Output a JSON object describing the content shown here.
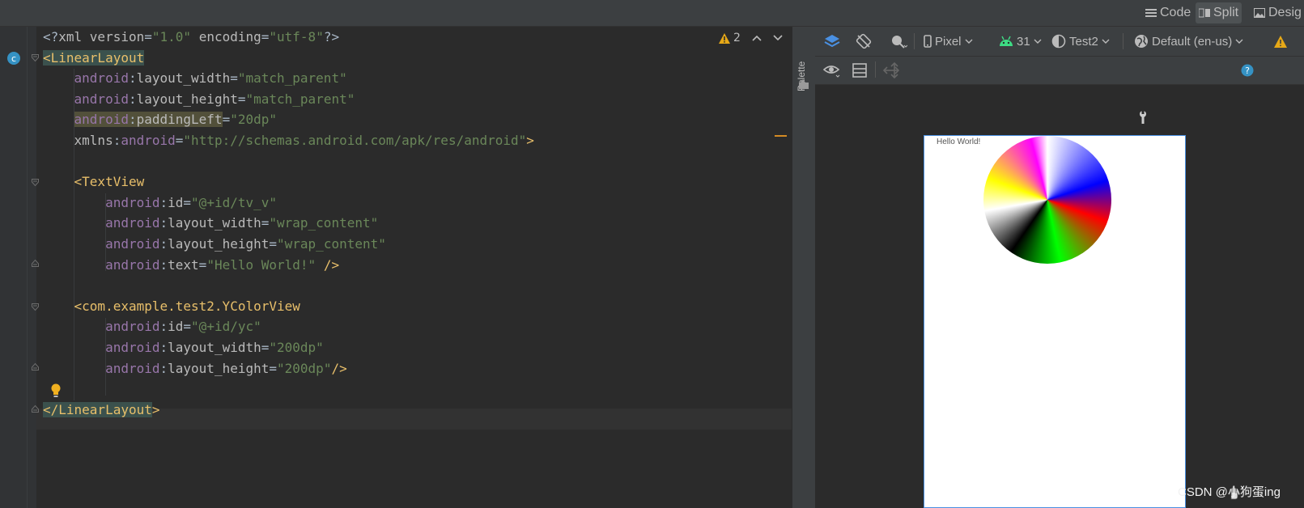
{
  "view_modes": {
    "code": "Code",
    "split": "Split",
    "design": "Desig"
  },
  "editor": {
    "warning_count": "2",
    "lines": [
      {
        "parts": [
          [
            "k-punc",
            "<?"
          ],
          [
            "k-attr",
            "xml version"
          ],
          [
            "k-punc",
            "="
          ],
          [
            "k-val",
            "\"1.0\""
          ],
          [
            "k-punc",
            " "
          ],
          [
            "k-attr",
            "encoding"
          ],
          [
            "k-punc",
            "="
          ],
          [
            "k-val",
            "\"utf-8\""
          ],
          [
            "k-punc",
            "?>"
          ]
        ]
      },
      {
        "parts": [
          [
            "k-tag hl-tag",
            "<LinearLayout"
          ]
        ]
      },
      {
        "parts": [
          [
            "k-punc",
            "    "
          ],
          [
            "k-ns",
            "android"
          ],
          [
            "k-punc",
            ":"
          ],
          [
            "k-attr",
            "layout_width"
          ],
          [
            "k-punc",
            "="
          ],
          [
            "k-val",
            "\"match_parent\""
          ]
        ]
      },
      {
        "parts": [
          [
            "k-punc",
            "    "
          ],
          [
            "k-ns",
            "android"
          ],
          [
            "k-punc",
            ":"
          ],
          [
            "k-attr",
            "layout_height"
          ],
          [
            "k-punc",
            "="
          ],
          [
            "k-val",
            "\"match_parent\""
          ]
        ]
      },
      {
        "parts": [
          [
            "k-punc",
            "    "
          ],
          [
            "k-ns hl-warn",
            "android"
          ],
          [
            "k-punc hl-warn",
            ":"
          ],
          [
            "k-attr hl-warn",
            "paddingLeft"
          ],
          [
            "k-punc",
            "="
          ],
          [
            "k-val",
            "\"20dp\""
          ]
        ]
      },
      {
        "parts": [
          [
            "k-punc",
            "    "
          ],
          [
            "k-attr",
            "xmlns"
          ],
          [
            "k-punc",
            ":"
          ],
          [
            "k-ns",
            "android"
          ],
          [
            "k-punc",
            "="
          ],
          [
            "k-val",
            "\"http://schemas.android.com/apk/res/android\""
          ],
          [
            "k-tag",
            ">"
          ]
        ]
      },
      {
        "parts": [
          [
            "k-punc",
            " "
          ]
        ]
      },
      {
        "parts": [
          [
            "k-punc",
            "    "
          ],
          [
            "k-tag",
            "<TextView"
          ]
        ]
      },
      {
        "parts": [
          [
            "k-punc",
            "        "
          ],
          [
            "k-ns",
            "android"
          ],
          [
            "k-punc",
            ":"
          ],
          [
            "k-attr",
            "id"
          ],
          [
            "k-punc",
            "="
          ],
          [
            "k-val",
            "\"@+id/tv_v\""
          ]
        ]
      },
      {
        "parts": [
          [
            "k-punc",
            "        "
          ],
          [
            "k-ns",
            "android"
          ],
          [
            "k-punc",
            ":"
          ],
          [
            "k-attr",
            "layout_width"
          ],
          [
            "k-punc",
            "="
          ],
          [
            "k-val",
            "\"wrap_content\""
          ]
        ]
      },
      {
        "parts": [
          [
            "k-punc",
            "        "
          ],
          [
            "k-ns",
            "android"
          ],
          [
            "k-punc",
            ":"
          ],
          [
            "k-attr",
            "layout_height"
          ],
          [
            "k-punc",
            "="
          ],
          [
            "k-val",
            "\"wrap_content\""
          ]
        ]
      },
      {
        "parts": [
          [
            "k-punc",
            "        "
          ],
          [
            "k-ns",
            "android"
          ],
          [
            "k-punc",
            ":"
          ],
          [
            "k-attr",
            "text"
          ],
          [
            "k-punc",
            "="
          ],
          [
            "k-val",
            "\"Hello World!\""
          ],
          [
            "k-punc",
            " "
          ],
          [
            "k-tag",
            "/>"
          ]
        ]
      },
      {
        "parts": [
          [
            "k-punc",
            " "
          ]
        ]
      },
      {
        "parts": [
          [
            "k-punc",
            "    "
          ],
          [
            "k-tag",
            "<com.example.test2.YColorView"
          ]
        ]
      },
      {
        "parts": [
          [
            "k-punc",
            "        "
          ],
          [
            "k-ns",
            "android"
          ],
          [
            "k-punc",
            ":"
          ],
          [
            "k-attr",
            "id"
          ],
          [
            "k-punc",
            "="
          ],
          [
            "k-val",
            "\"@+id/yc\""
          ]
        ]
      },
      {
        "parts": [
          [
            "k-punc",
            "        "
          ],
          [
            "k-ns",
            "android"
          ],
          [
            "k-punc",
            ":"
          ],
          [
            "k-attr",
            "layout_width"
          ],
          [
            "k-punc",
            "="
          ],
          [
            "k-val",
            "\"200dp\""
          ]
        ]
      },
      {
        "parts": [
          [
            "k-punc",
            "        "
          ],
          [
            "k-ns",
            "android"
          ],
          [
            "k-punc",
            ":"
          ],
          [
            "k-attr",
            "layout_height"
          ],
          [
            "k-punc",
            "="
          ],
          [
            "k-val",
            "\"200dp\""
          ],
          [
            "k-tag",
            "/>"
          ]
        ]
      },
      {
        "parts": [
          [
            "k-punc",
            " "
          ]
        ]
      },
      {
        "parts": [
          [
            "k-tag hl-tag",
            "</LinearLayout"
          ],
          [
            "k-tag",
            ">"
          ]
        ]
      }
    ]
  },
  "palette": {
    "label": "Palette"
  },
  "design_toolbar": {
    "device": "Pixel",
    "api": "31",
    "theme": "Test2",
    "locale": "Default (en-us)"
  },
  "preview": {
    "text": "Hello World!"
  },
  "watermark": "CSDN @小狗蛋ing",
  "colors": {
    "accent": "#4a90e2",
    "warning": "#e6a817",
    "android": "#3ddc84"
  }
}
